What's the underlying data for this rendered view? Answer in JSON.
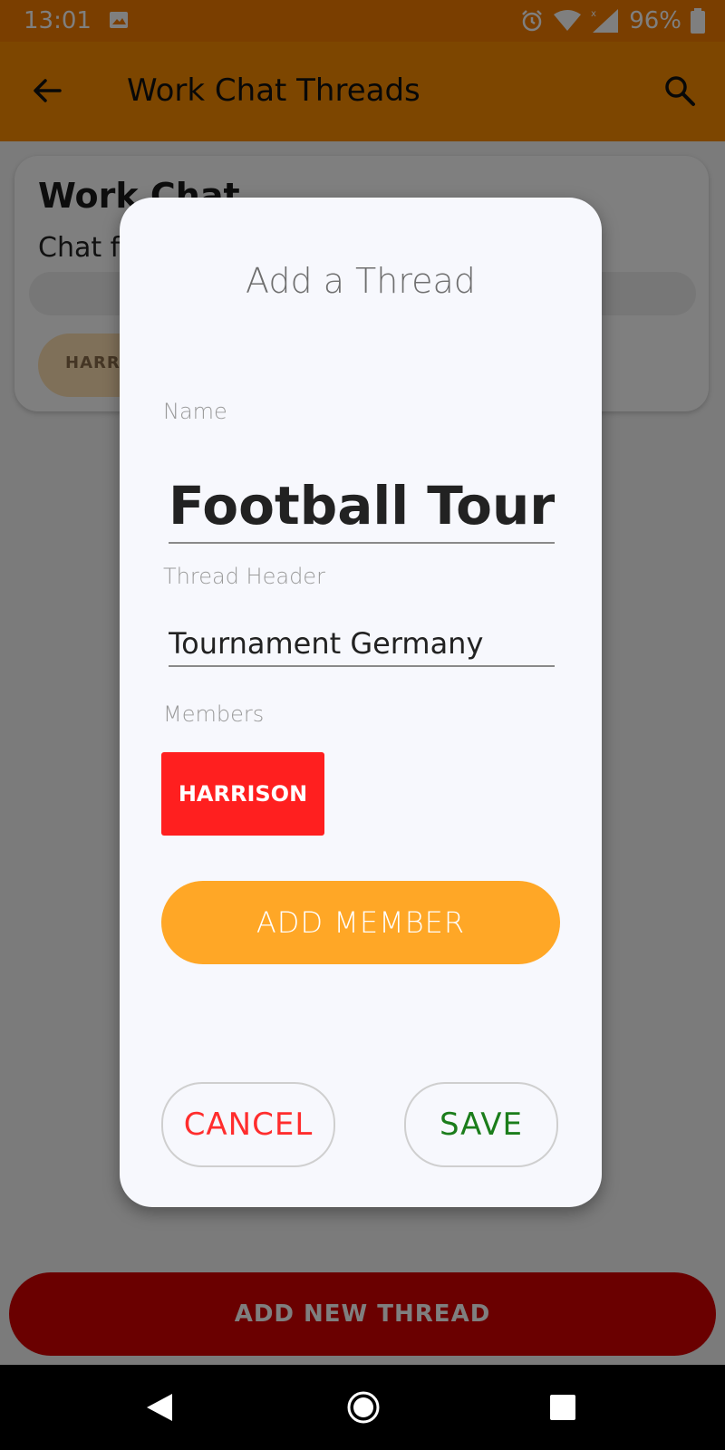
{
  "status_bar": {
    "time": "13:01",
    "battery": "96%",
    "icons": [
      "image-icon",
      "alarm-icon",
      "wifi-icon",
      "signal-icon",
      "battery-icon"
    ]
  },
  "app_bar": {
    "title": "Work Chat Threads",
    "back_icon": "arrow-back-icon",
    "search_icon": "search-icon"
  },
  "background_card": {
    "title": "Work Chat",
    "subtitle": "Chat f",
    "chip_label": "HARR"
  },
  "bottom_button": {
    "label": "ADD NEW THREAD"
  },
  "dialog": {
    "title": "Add a Thread",
    "name": {
      "label": "Name",
      "value": "Football Tour"
    },
    "thread_header": {
      "label": "Thread Header",
      "value": "Tournament Germany"
    },
    "members": {
      "label": "Members",
      "items": [
        "HARRISON"
      ]
    },
    "add_member_label": "ADD MEMBER",
    "cancel_label": "CANCEL",
    "save_label": "SAVE"
  },
  "colors": {
    "primary": "#fb8c00",
    "status_bar": "#f57c00",
    "accent_button": "#ffa726",
    "member_chip": "#ff1f1f",
    "danger": "#d50000",
    "save_text": "#1b7d1b",
    "cancel_text": "#ff2d2d"
  },
  "nav_bar": {
    "icons": [
      "nav-back-icon",
      "nav-home-icon",
      "nav-recents-icon"
    ]
  }
}
